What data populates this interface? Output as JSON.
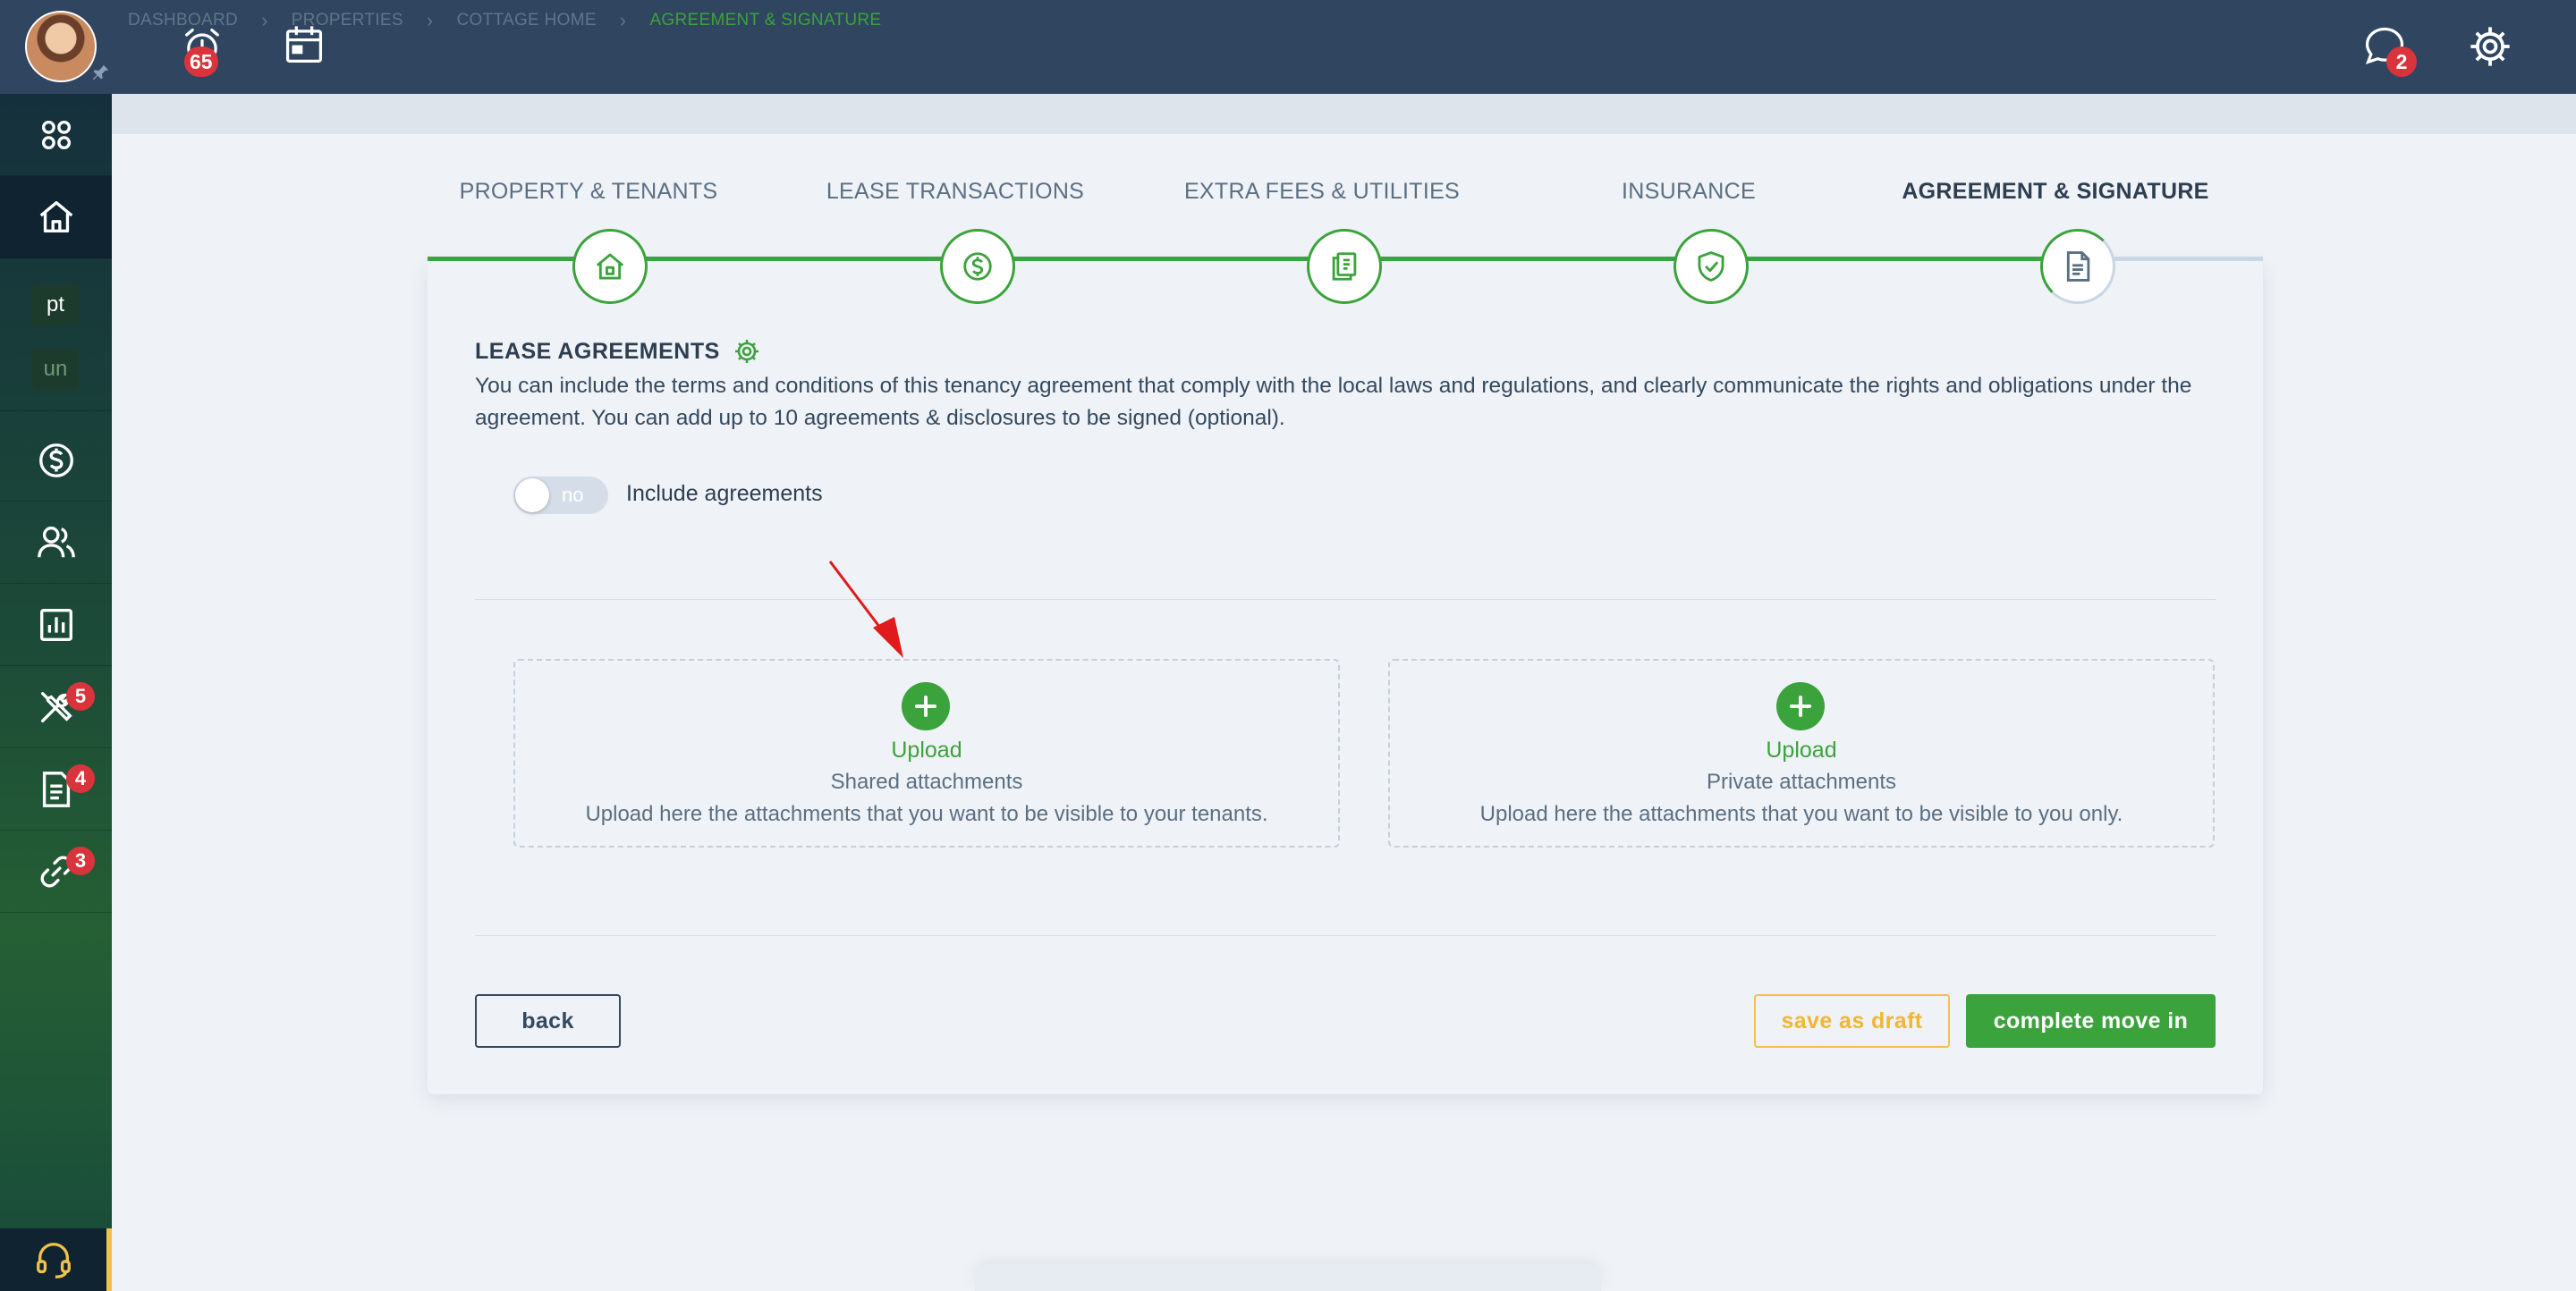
{
  "topbar": {
    "alerts_badge": "65",
    "messages_badge": "2"
  },
  "sidebar": {
    "chip_pt": "pt",
    "chip_un": "un",
    "maintenance_badge": "5",
    "documents_badge": "4",
    "links_badge": "3"
  },
  "breadcrumb": {
    "items": [
      "DASHBOARD",
      "PROPERTIES",
      "COTTAGE HOME",
      "AGREEMENT & SIGNATURE"
    ]
  },
  "steps": [
    {
      "label": "PROPERTY & TENANTS",
      "icon": "home-icon"
    },
    {
      "label": "LEASE TRANSACTIONS",
      "icon": "dollar-icon"
    },
    {
      "label": "EXTRA FEES & UTILITIES",
      "icon": "receipt-icon"
    },
    {
      "label": "INSURANCE",
      "icon": "shield-check-icon"
    },
    {
      "label": "AGREEMENT & SIGNATURE",
      "icon": "document-icon"
    }
  ],
  "section": {
    "title": "LEASE AGREEMENTS",
    "description": "You can include the terms and conditions of this tenancy agreement that comply with the local laws and regulations, and clearly communicate the rights and obligations under the agreement. You can add up to 10 agreements & disclosures to be signed (optional).",
    "toggle_state": "no",
    "toggle_label": "Include agreements"
  },
  "uploads": [
    {
      "title": "Upload",
      "subtitle": "Shared attachments",
      "description": "Upload here the attachments that you want to be visible to your tenants."
    },
    {
      "title": "Upload",
      "subtitle": "Private attachments",
      "description": "Upload here the attachments that you want to be visible to you only."
    }
  ],
  "buttons": {
    "back": "back",
    "save_draft": "save as draft",
    "complete": "complete move in"
  },
  "colors": {
    "accent_green": "#3ba33b",
    "topbar": "#2f4560",
    "badge_red": "#d9343b",
    "draft_yellow": "#f2c14e"
  }
}
